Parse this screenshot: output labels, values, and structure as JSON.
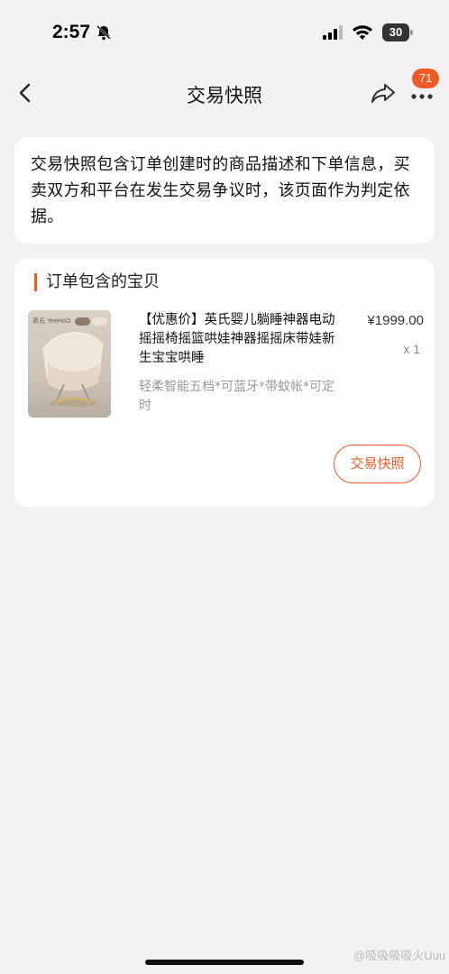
{
  "status_bar": {
    "time": "2:57",
    "battery": "30"
  },
  "nav": {
    "title": "交易快照",
    "badge_count": "71"
  },
  "info": {
    "text": "交易快照包含订单创建时的商品描述和下单信息，买卖双方和平台在发生交易争议时，该页面作为判定依据。"
  },
  "order": {
    "section_title": "订单包含的宝贝",
    "product": {
      "brand": "英氏 YeeHoO",
      "name": "【优惠价】英氏婴儿躺睡神器电动摇摇椅摇篮哄娃神器摇摇床带娃新生宝宝哄睡",
      "price": "¥1999.00",
      "quantity": "x 1",
      "spec": "轻柔智能五档*可蓝牙*带蚊帐*可定时"
    },
    "snapshot_button": "交易快照"
  },
  "watermark": "@吸吸吸吸火Uuu",
  "colors": {
    "accent": "#f15a24",
    "background": "#f2f2f2",
    "card": "#ffffff"
  }
}
